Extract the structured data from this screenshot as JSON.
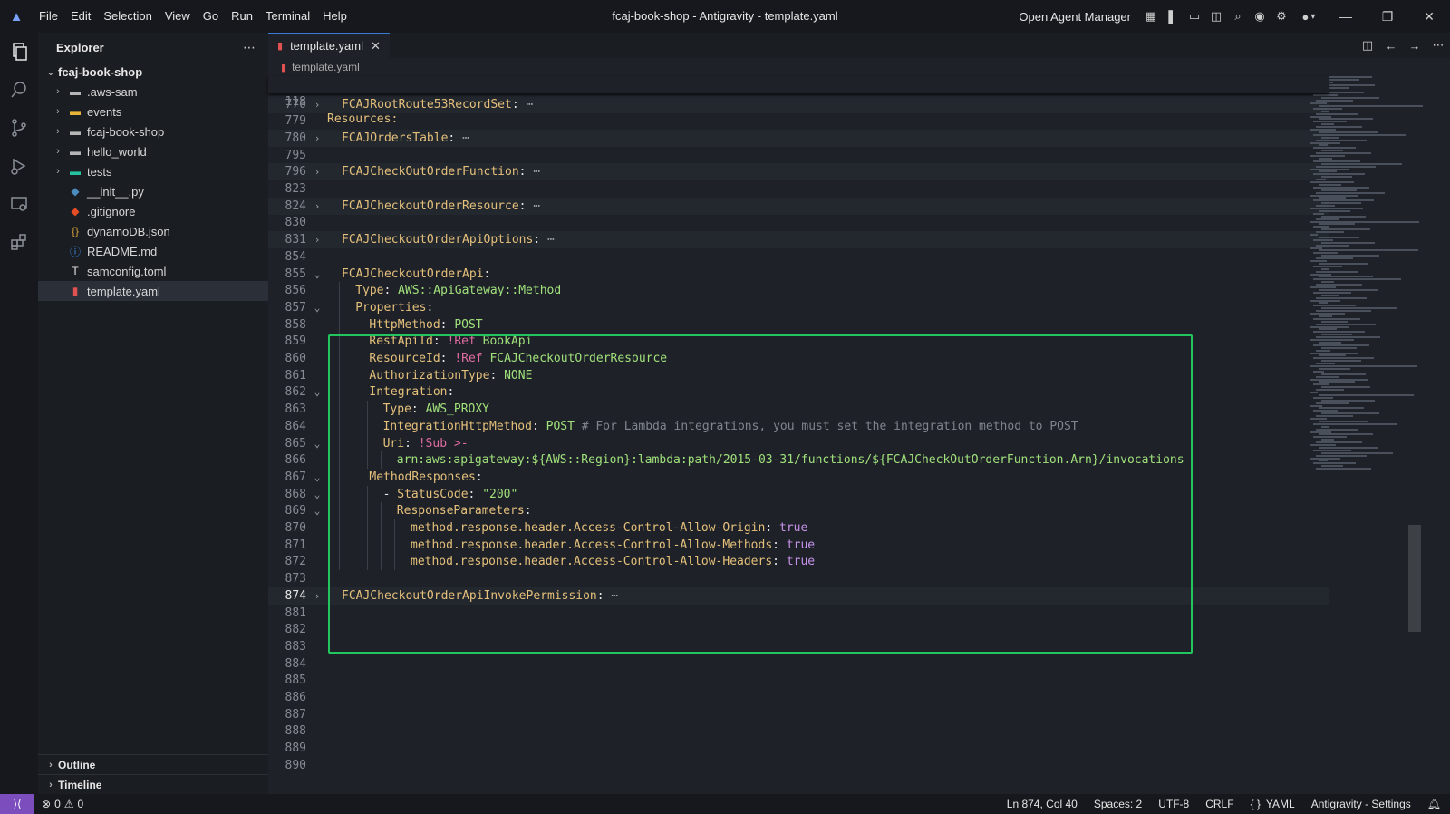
{
  "titlebar": {
    "menu": [
      "File",
      "Edit",
      "Selection",
      "View",
      "Go",
      "Run",
      "Terminal",
      "Help"
    ],
    "window_title": "fcaj-book-shop - Antigravity - template.yaml",
    "agent_manager": "Open Agent Manager"
  },
  "sidebar": {
    "title": "Explorer",
    "root": "fcaj-book-shop",
    "items": [
      {
        "label": ".aws-sam",
        "type": "folder",
        "icon": "folder-icon",
        "color": "#b5b5b5"
      },
      {
        "label": "events",
        "type": "folder",
        "icon": "folder-icon",
        "color": "#e8b339"
      },
      {
        "label": "fcaj-book-shop",
        "type": "folder",
        "icon": "folder-icon",
        "color": "#b5b5b5"
      },
      {
        "label": "hello_world",
        "type": "folder",
        "icon": "folder-icon",
        "color": "#b5b5b5"
      },
      {
        "label": "tests",
        "type": "folder",
        "icon": "test-folder-icon",
        "color": "#25c2a0"
      },
      {
        "label": "__init__.py",
        "type": "file",
        "icon": "python-icon",
        "color": "#4b8bbe"
      },
      {
        "label": ".gitignore",
        "type": "file",
        "icon": "git-icon",
        "color": "#e44d26"
      },
      {
        "label": "dynamoDB.json",
        "type": "file",
        "icon": "json-icon",
        "color": "#d7a43a"
      },
      {
        "label": "README.md",
        "type": "file",
        "icon": "info-icon",
        "color": "#3b8eea"
      },
      {
        "label": "samconfig.toml",
        "type": "file",
        "icon": "toml-icon",
        "color": "#e6e6e6"
      },
      {
        "label": "template.yaml",
        "type": "file",
        "icon": "yaml-icon",
        "color": "#e05252",
        "selected": true
      }
    ],
    "panels": [
      "Outline",
      "Timeline"
    ]
  },
  "editor": {
    "tab": "template.yaml",
    "breadcrumb": "template.yaml",
    "sticky": {
      "num": "118",
      "text": "Resources:"
    },
    "lines": [
      {
        "num": "770",
        "fold": "closed",
        "parts": [
          [
            "k",
            "FCAJRootRoute53RecordSet"
          ],
          [
            "p",
            ": "
          ],
          [
            "dots",
            "⋯"
          ]
        ],
        "indent": 1
      },
      {
        "num": "779",
        "parts": []
      },
      {
        "num": "780",
        "fold": "closed",
        "parts": [
          [
            "k",
            "FCAJOrdersTable"
          ],
          [
            "p",
            ": "
          ],
          [
            "dots",
            "⋯"
          ]
        ],
        "indent": 1
      },
      {
        "num": "795",
        "parts": []
      },
      {
        "num": "796",
        "fold": "closed",
        "parts": [
          [
            "k",
            "FCAJCheckOutOrderFunction"
          ],
          [
            "p",
            ": "
          ],
          [
            "dots",
            "⋯"
          ]
        ],
        "indent": 1
      },
      {
        "num": "823",
        "parts": []
      },
      {
        "num": "824",
        "fold": "closed",
        "parts": [
          [
            "k",
            "FCAJCheckoutOrderResource"
          ],
          [
            "p",
            ": "
          ],
          [
            "dots",
            "⋯"
          ]
        ],
        "indent": 1
      },
      {
        "num": "830",
        "parts": []
      },
      {
        "num": "831",
        "fold": "closed",
        "parts": [
          [
            "k",
            "FCAJCheckoutOrderApiOptions"
          ],
          [
            "p",
            ": "
          ],
          [
            "dots",
            "⋯"
          ]
        ],
        "indent": 1
      },
      {
        "num": "854",
        "parts": []
      },
      {
        "num": "855",
        "fold": "open",
        "parts": [
          [
            "k",
            "FCAJCheckoutOrderApi"
          ],
          [
            "p",
            ":"
          ]
        ],
        "indent": 1
      },
      {
        "num": "856",
        "parts": [
          [
            "k",
            "Type"
          ],
          [
            "p",
            ": "
          ],
          [
            "s",
            "AWS::ApiGateway::Method"
          ]
        ],
        "indent": 2
      },
      {
        "num": "857",
        "fold": "open",
        "parts": [
          [
            "k",
            "Properties"
          ],
          [
            "p",
            ":"
          ]
        ],
        "indent": 2
      },
      {
        "num": "858",
        "parts": [
          [
            "k",
            "HttpMethod"
          ],
          [
            "p",
            ": "
          ],
          [
            "s",
            "POST"
          ]
        ],
        "indent": 3
      },
      {
        "num": "859",
        "parts": [
          [
            "k",
            "RestApiId"
          ],
          [
            "p",
            ": "
          ],
          [
            "tag",
            "!Ref "
          ],
          [
            "s",
            "BookApi"
          ]
        ],
        "indent": 3
      },
      {
        "num": "860",
        "parts": [
          [
            "k",
            "ResourceId"
          ],
          [
            "p",
            ": "
          ],
          [
            "tag",
            "!Ref "
          ],
          [
            "s",
            "FCAJCheckoutOrderResource"
          ]
        ],
        "indent": 3
      },
      {
        "num": "861",
        "parts": [
          [
            "k",
            "AuthorizationType"
          ],
          [
            "p",
            ": "
          ],
          [
            "s",
            "NONE"
          ]
        ],
        "indent": 3
      },
      {
        "num": "862",
        "fold": "open",
        "parts": [
          [
            "k",
            "Integration"
          ],
          [
            "p",
            ":"
          ]
        ],
        "indent": 3
      },
      {
        "num": "863",
        "parts": [
          [
            "k",
            "Type"
          ],
          [
            "p",
            ": "
          ],
          [
            "s",
            "AWS_PROXY"
          ]
        ],
        "indent": 4
      },
      {
        "num": "864",
        "parts": [
          [
            "k",
            "IntegrationHttpMethod"
          ],
          [
            "p",
            ": "
          ],
          [
            "s",
            "POST"
          ],
          [
            "cmt",
            " # For Lambda integrations, you must set the integration method to POST"
          ]
        ],
        "indent": 4
      },
      {
        "num": "865",
        "fold": "open",
        "parts": [
          [
            "k",
            "Uri"
          ],
          [
            "p",
            ": "
          ],
          [
            "tag",
            "!Sub >-"
          ]
        ],
        "indent": 4
      },
      {
        "num": "866",
        "parts": [
          [
            "s",
            "arn:aws:apigateway:${AWS::Region}:lambda:path/2015-03-31/functions/${FCAJCheckOutOrderFunction.Arn}/invocations"
          ]
        ],
        "indent": 5
      },
      {
        "num": "867",
        "fold": "open",
        "parts": [
          [
            "k",
            "MethodResponses"
          ],
          [
            "p",
            ":"
          ]
        ],
        "indent": 3
      },
      {
        "num": "868",
        "fold": "open",
        "parts": [
          [
            "p",
            "- "
          ],
          [
            "k",
            "StatusCode"
          ],
          [
            "p",
            ": "
          ],
          [
            "s",
            "\"200\""
          ]
        ],
        "indent": 4
      },
      {
        "num": "869",
        "fold": "open",
        "parts": [
          [
            "k",
            "ResponseParameters"
          ],
          [
            "p",
            ":"
          ]
        ],
        "indent": 5
      },
      {
        "num": "870",
        "parts": [
          [
            "k",
            "method.response.header.Access-Control-Allow-Origin"
          ],
          [
            "p",
            ": "
          ],
          [
            "bool",
            "true"
          ]
        ],
        "indent": 6
      },
      {
        "num": "871",
        "parts": [
          [
            "k",
            "method.response.header.Access-Control-Allow-Methods"
          ],
          [
            "p",
            ": "
          ],
          [
            "bool",
            "true"
          ]
        ],
        "indent": 6
      },
      {
        "num": "872",
        "parts": [
          [
            "k",
            "method.response.header.Access-Control-Allow-Headers"
          ],
          [
            "p",
            ": "
          ],
          [
            "bool",
            "true"
          ]
        ],
        "indent": 6
      },
      {
        "num": "873",
        "parts": []
      },
      {
        "num": "874",
        "fold": "closed",
        "current": true,
        "parts": [
          [
            "k",
            "FCAJCheckoutOrderApiInvokePermission"
          ],
          [
            "p",
            ": "
          ],
          [
            "dots",
            "⋯"
          ]
        ],
        "indent": 1
      },
      {
        "num": "881",
        "parts": []
      },
      {
        "num": "882",
        "parts": []
      },
      {
        "num": "883",
        "parts": []
      },
      {
        "num": "884",
        "parts": []
      },
      {
        "num": "885",
        "parts": []
      },
      {
        "num": "886",
        "parts": []
      },
      {
        "num": "887",
        "parts": []
      },
      {
        "num": "888",
        "parts": []
      },
      {
        "num": "889",
        "parts": []
      },
      {
        "num": "890",
        "parts": []
      }
    ]
  },
  "statusbar": {
    "errors": "0",
    "warnings": "0",
    "position": "Ln 874, Col 40",
    "spaces": "Spaces: 2",
    "encoding": "UTF-8",
    "eol": "CRLF",
    "language": "YAML",
    "settings": "Antigravity - Settings"
  }
}
